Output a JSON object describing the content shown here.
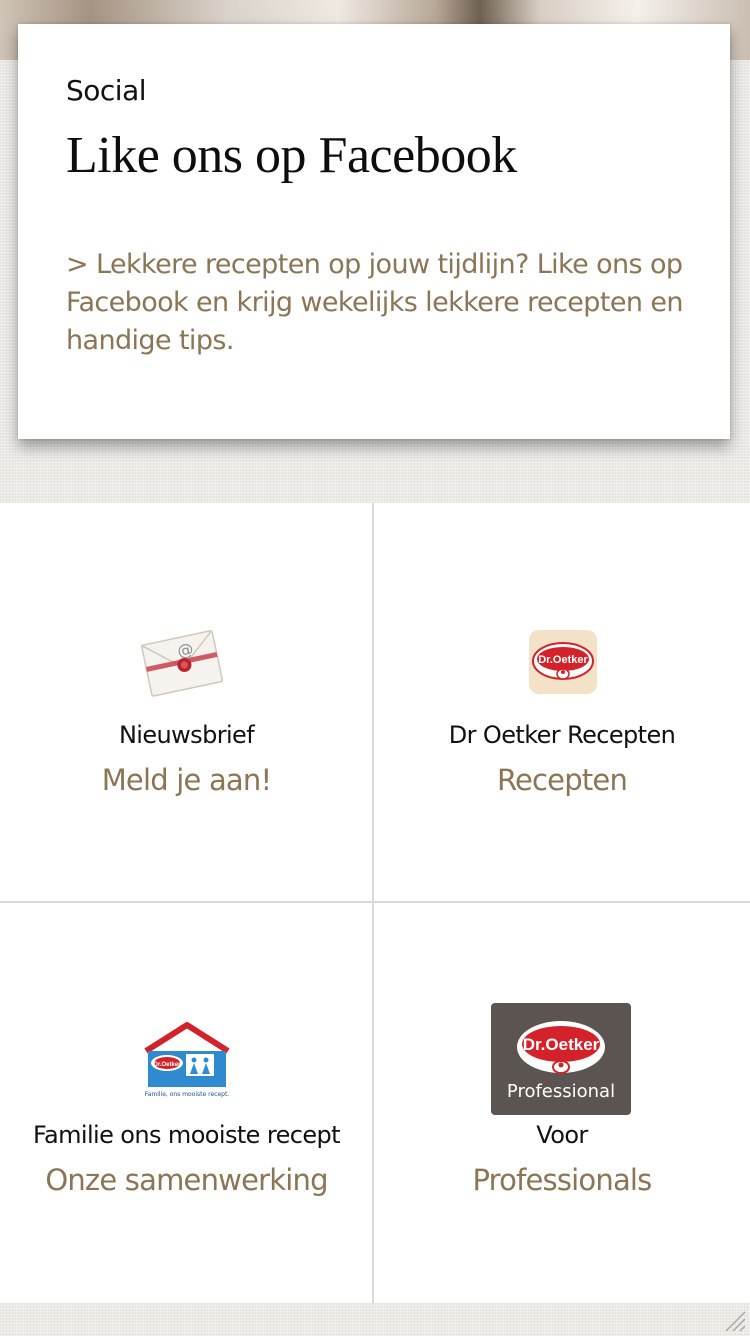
{
  "social_card": {
    "label": "Social",
    "title": "Like ons op Facebook",
    "text": "> Lekkere recepten op jouw tijdlijn? Like ons op Facebook en krijg wekelijks lekkere recepten en handige tips."
  },
  "tiles": [
    {
      "title": "Nieuwsbrief",
      "link": "Meld je aan!",
      "icon": "newsletter-envelope-icon"
    },
    {
      "title": "Dr Oetker Recepten",
      "link": "Recepten",
      "icon": "dr-oetker-logo-icon"
    },
    {
      "title": "Familie ons mooiste recept",
      "link": "Onze samenwerking",
      "icon": "familie-house-icon"
    },
    {
      "title": "Voor",
      "link": "Professionals",
      "icon": "dr-oetker-professional-logo-icon"
    }
  ],
  "logos": {
    "brand_text": "Dr.Oetker",
    "professional_text": "Professional",
    "familie_caption": "Familie, ons mooiste recept."
  },
  "colors": {
    "accent_text": "#8a7556",
    "brand_red": "#d3222a",
    "brand_blue": "#2e8bd0",
    "professional_bg": "#5b5450"
  }
}
